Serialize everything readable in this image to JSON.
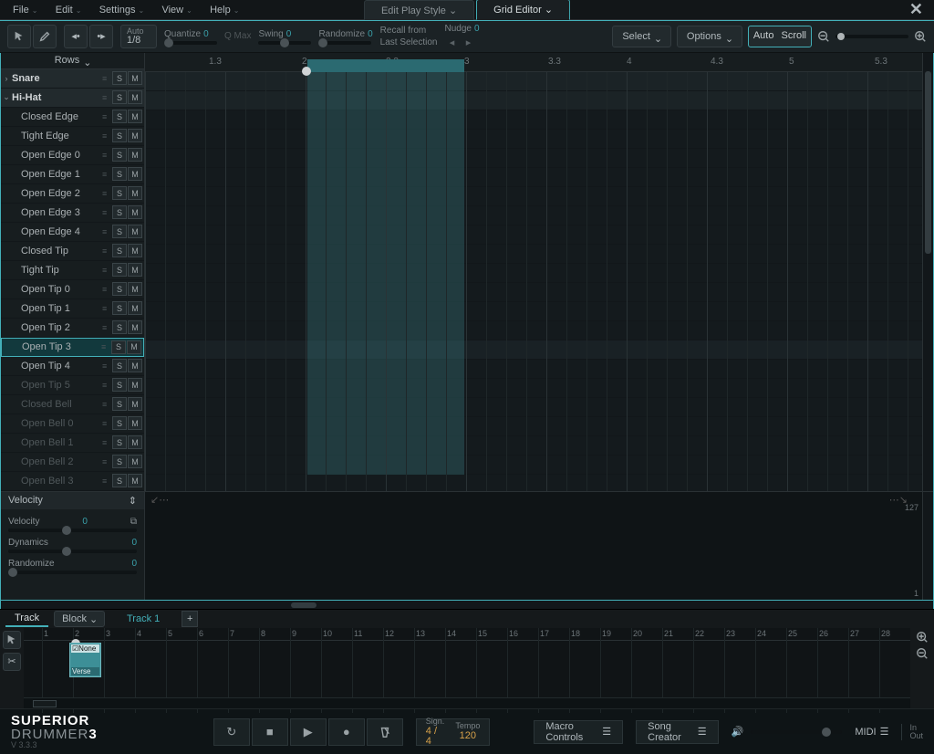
{
  "menu": {
    "items": [
      "File",
      "Edit",
      "Settings",
      "View",
      "Help"
    ]
  },
  "tabs": {
    "edit_play_style": "Edit Play Style",
    "grid_editor": "Grid Editor",
    "active": "grid_editor"
  },
  "toolbar": {
    "auto": {
      "label": "Auto",
      "value": "1/8"
    },
    "quantize": {
      "label": "Quantize",
      "value": "0"
    },
    "qmax": "Q Max",
    "swing": {
      "label": "Swing",
      "value": "0"
    },
    "randomize": {
      "label": "Randomize",
      "value": "0"
    },
    "recall": {
      "l1": "Recall from",
      "l2": "Last Selection"
    },
    "nudge": {
      "label": "Nudge",
      "value": "0"
    },
    "select": "Select",
    "options": "Options",
    "autoscroll": {
      "l1": "Auto",
      "l2": "Scroll"
    }
  },
  "rows_header": "Rows",
  "ruler": [
    "1.3",
    "2",
    "2.3",
    "3",
    "3.3",
    "4",
    "4.3",
    "5",
    "5.3"
  ],
  "tracks": [
    {
      "name": "Snare",
      "parent": true,
      "exp": "›",
      "dim": false
    },
    {
      "name": "Hi-Hat",
      "parent": true,
      "exp": "⌄",
      "dim": false
    },
    {
      "name": "Closed Edge",
      "dim": false
    },
    {
      "name": "Tight Edge",
      "dim": false
    },
    {
      "name": "Open Edge 0",
      "dim": false
    },
    {
      "name": "Open Edge 1",
      "dim": false
    },
    {
      "name": "Open Edge 2",
      "dim": false
    },
    {
      "name": "Open Edge 3",
      "dim": false
    },
    {
      "name": "Open Edge 4",
      "dim": false
    },
    {
      "name": "Closed Tip",
      "dim": false
    },
    {
      "name": "Tight Tip",
      "dim": false
    },
    {
      "name": "Open Tip 0",
      "dim": false
    },
    {
      "name": "Open Tip 1",
      "dim": false
    },
    {
      "name": "Open Tip 2",
      "dim": false
    },
    {
      "name": "Open Tip 3",
      "dim": false,
      "selected": true
    },
    {
      "name": "Open Tip 4",
      "dim": false
    },
    {
      "name": "Open Tip 5",
      "dim": true
    },
    {
      "name": "Closed Bell",
      "dim": true
    },
    {
      "name": "Open Bell 0",
      "dim": true
    },
    {
      "name": "Open Bell 1",
      "dim": true
    },
    {
      "name": "Open Bell 2",
      "dim": true
    },
    {
      "name": "Open Bell 3",
      "dim": true
    }
  ],
  "velocity": {
    "header": "Velocity",
    "velocity": {
      "label": "Velocity",
      "value": "0"
    },
    "dynamics": {
      "label": "Dynamics",
      "value": "0"
    },
    "randomize": {
      "label": "Randomize",
      "value": "0"
    },
    "max": "127",
    "min": "1"
  },
  "trackview": {
    "track_tab": "Track",
    "block": "Block",
    "track_name": "Track 1",
    "clip": {
      "top": "☑None",
      "bottom": "Verse"
    },
    "ruler": [
      1,
      2,
      3,
      4,
      5,
      6,
      7,
      8,
      9,
      10,
      11,
      12,
      13,
      14,
      15,
      16,
      17,
      18,
      19,
      20,
      21,
      22,
      23,
      24,
      25,
      26,
      27,
      28
    ]
  },
  "bottom": {
    "brand_bold": "SUPERIOR",
    "brand_light": " DRUMMER",
    "brand_num": "3",
    "version": "V 3.3.3",
    "sign": {
      "label": "Sign.",
      "value": "4 / 4"
    },
    "tempo": {
      "label": "Tempo",
      "value": "120"
    },
    "macro": "Macro Controls",
    "song": "Song Creator",
    "midi": "MIDI",
    "io": {
      "in": "In",
      "out": "Out"
    }
  }
}
